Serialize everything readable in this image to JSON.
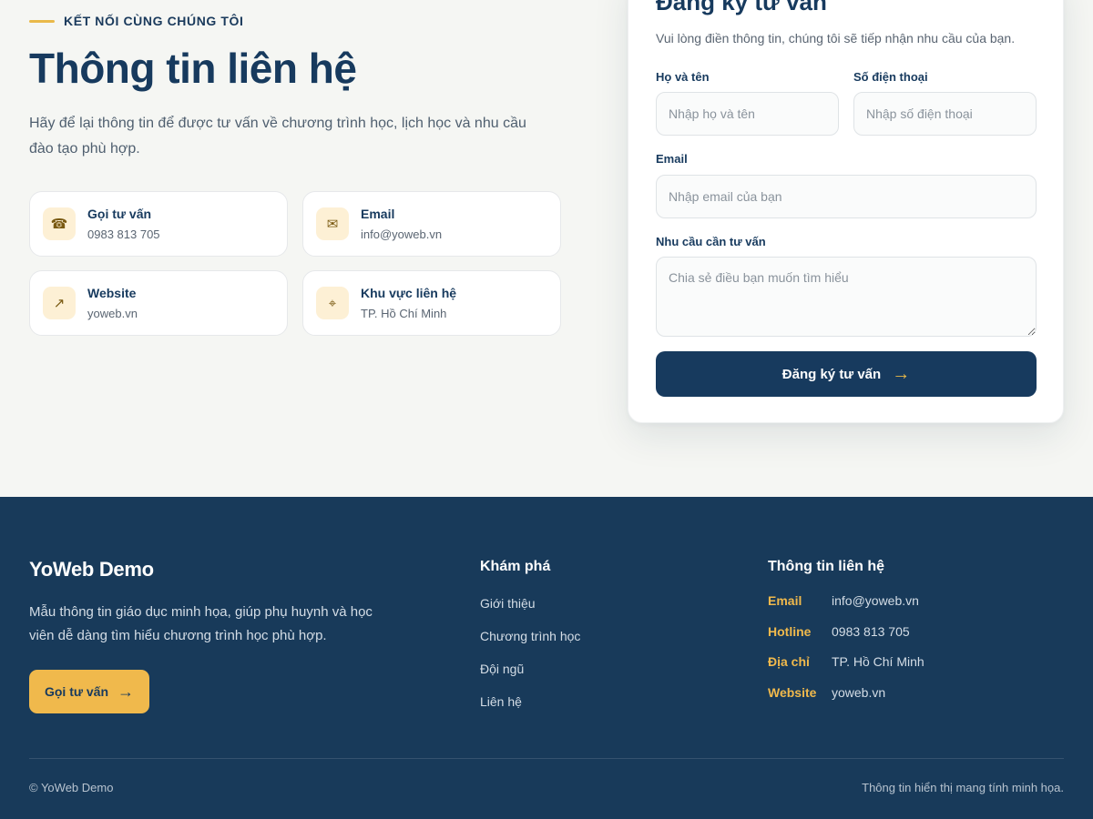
{
  "contact": {
    "eyebrow": "KẾT NỐI CÙNG CHÚNG TÔI",
    "title": "Thông tin liên hệ",
    "intro": "Hãy để lại thông tin để được tư vấn về chương trình học, lịch học và nhu cầu đào tạo phù hợp.",
    "cards": [
      {
        "icon": "phone-icon",
        "glyph": "☎",
        "title": "Gọi tư vấn",
        "value": "0983 813 705"
      },
      {
        "icon": "mail-icon",
        "glyph": "✉",
        "title": "Email",
        "value": "info@yoweb.vn"
      },
      {
        "icon": "external-link-icon",
        "glyph": "↗",
        "title": "Website",
        "value": "yoweb.vn"
      },
      {
        "icon": "location-icon",
        "glyph": "⌖",
        "title": "Khu vực liên hệ",
        "value": "TP. Hồ Chí Minh"
      }
    ]
  },
  "form": {
    "title": "Đăng ký tư vấn",
    "subtitle": "Vui lòng điền thông tin, chúng tôi sẽ tiếp nhận nhu cầu của bạn.",
    "name_label": "Họ và tên",
    "name_placeholder": "Nhập họ và tên",
    "name_value": "",
    "phone_label": "Số điện thoại",
    "phone_placeholder": "Nhập số điện thoại",
    "phone_value": "",
    "email_label": "Email",
    "email_placeholder": "Nhập email của bạn",
    "email_value": "",
    "need_label": "Nhu cầu cần tư vấn",
    "need_placeholder": "Chia sẻ điều bạn muốn tìm hiểu",
    "need_value": "",
    "submit_label": "Đăng ký tư vấn",
    "submit_arrow": "→"
  },
  "footer": {
    "brand": "YoWeb Demo",
    "description": "Mẫu thông tin giáo dục minh họa, giúp phụ huynh và học viên dễ dàng tìm hiểu chương trình học phù hợp.",
    "cta_label": "Gọi tư vấn",
    "cta_arrow": "→",
    "explore_title": "Khám phá",
    "explore_links": [
      "Giới thiệu",
      "Chương trình học",
      "Đội ngũ",
      "Liên hệ"
    ],
    "contact_title": "Thông tin liên hệ",
    "contact_rows": [
      {
        "key": "Email",
        "value": "info@yoweb.vn"
      },
      {
        "key": "Hotline",
        "value": "0983 813 705"
      },
      {
        "key": "Địa chỉ",
        "value": "TP. Hồ Chí Minh"
      },
      {
        "key": "Website",
        "value": "yoweb.vn"
      }
    ],
    "copyright": "© YoWeb Demo",
    "disclaimer": "Thông tin hiển thị mang tính minh họa."
  },
  "colors": {
    "primary": "#173a5e",
    "accent": "#f0b94c",
    "background": "#f5f6f3",
    "footer_bg": "#183a5a"
  }
}
